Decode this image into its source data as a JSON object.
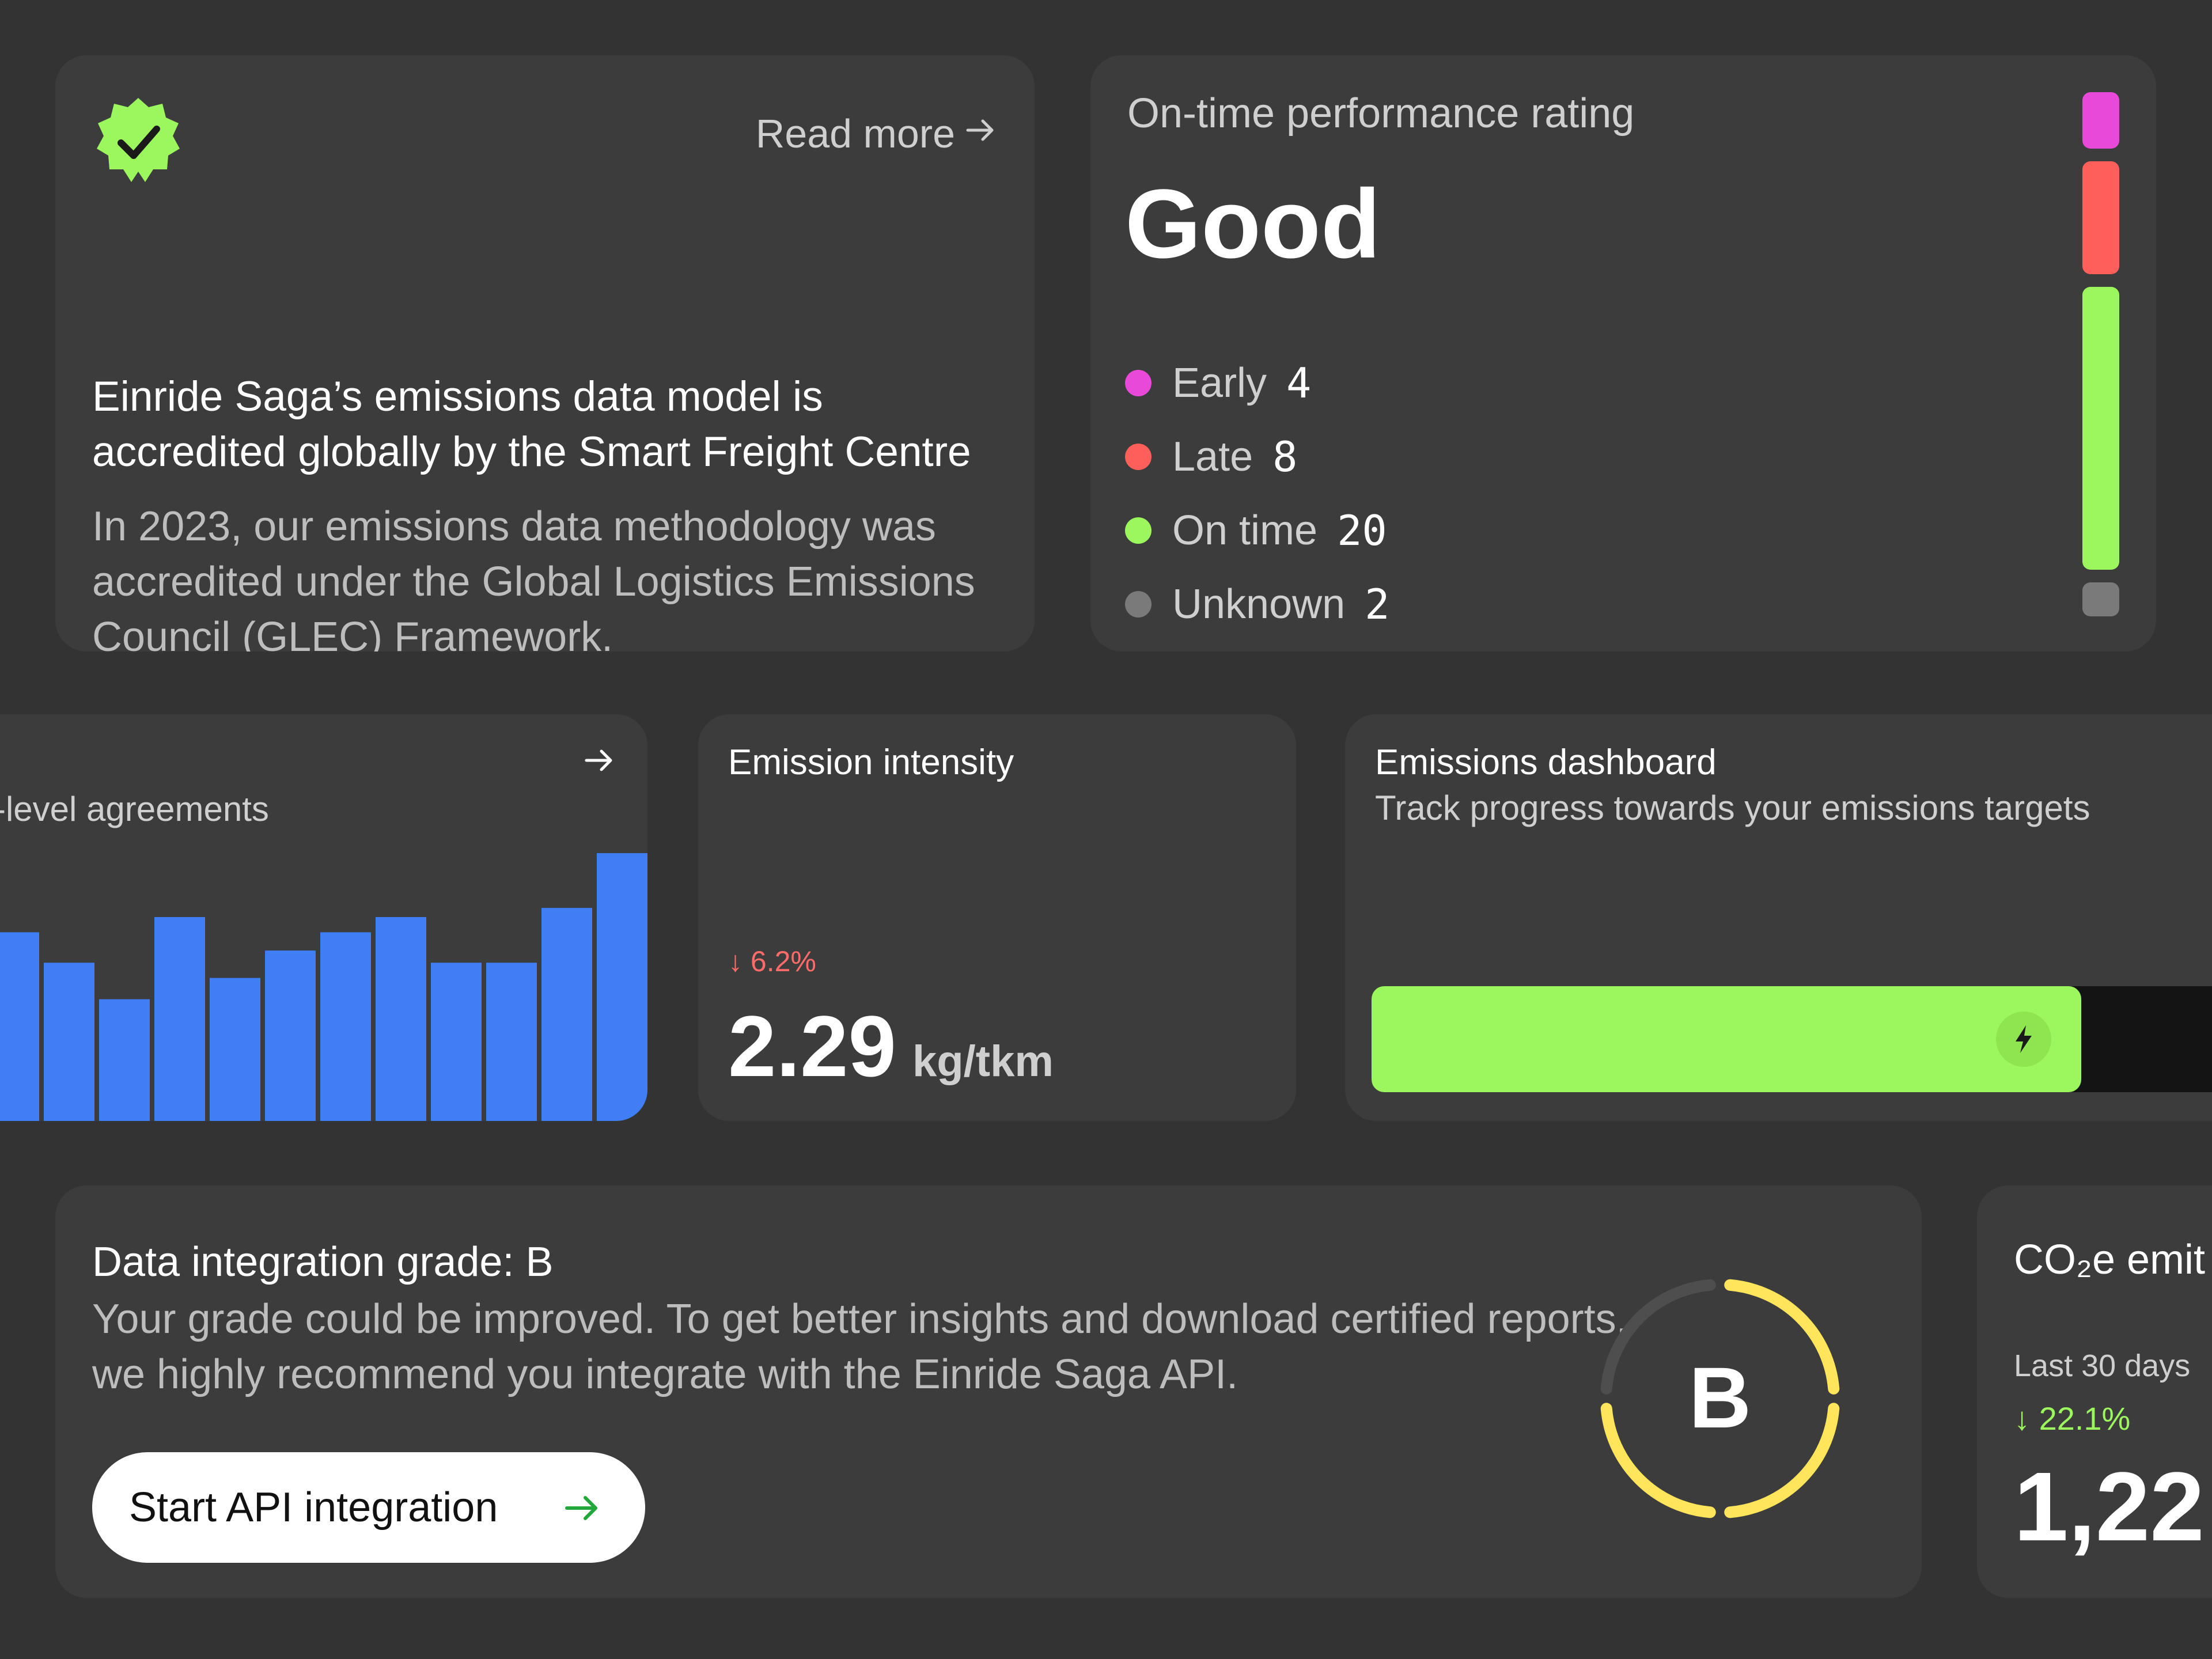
{
  "accreditation": {
    "read_more": "Read more",
    "title": "Einride Saga’s emissions data model is accredited globally by the Smart Freight Centre",
    "body": "In 2023, our emissions data methodology was accredited under the Global Logistics Emissions Council (GLEC) Framework.",
    "badge_color": "#9cf75f"
  },
  "ontime": {
    "label": "On-time performance rating",
    "rating": "Good",
    "legend": [
      {
        "label": "Early",
        "count": "4",
        "color": "#e849d8"
      },
      {
        "label": "Late",
        "count": "8",
        "color": "#ff5f5a"
      },
      {
        "label": "On time",
        "count": "20",
        "color": "#9cf75f"
      },
      {
        "label": "Unknown",
        "count": "2",
        "color": "#7a7a7a"
      }
    ]
  },
  "sla": {
    "label": "-level agreements",
    "bar_color": "#3f7ef5",
    "chart_data": {
      "type": "bar",
      "values": [
        62,
        52,
        40,
        67,
        47,
        56,
        62,
        67,
        52,
        52,
        70,
        88
      ],
      "ylim": [
        0,
        100
      ]
    }
  },
  "intensity": {
    "label": "Emission intensity",
    "change": "6.2%",
    "value": "2.29",
    "unit": "kg/tkm"
  },
  "dashboard": {
    "title": "Emissions dashboard",
    "subtitle": "Track progress towards your emissions targets",
    "progress": 0.77,
    "fill_color": "#9cf75f"
  },
  "grade": {
    "title": "Data integration grade:  B",
    "body": "Your grade could be improved. To get better insights and download certified reports, we highly recommend you integrate with the Einride Saga API.",
    "button_label": "Start API integration",
    "letter": "B",
    "ring_color": "#ffe55c",
    "filled_segments": 3,
    "total_segments": 4
  },
  "co2": {
    "title": "CO₂e emit",
    "period": "Last 30 days",
    "change": "22.1%",
    "value": "1,22"
  }
}
